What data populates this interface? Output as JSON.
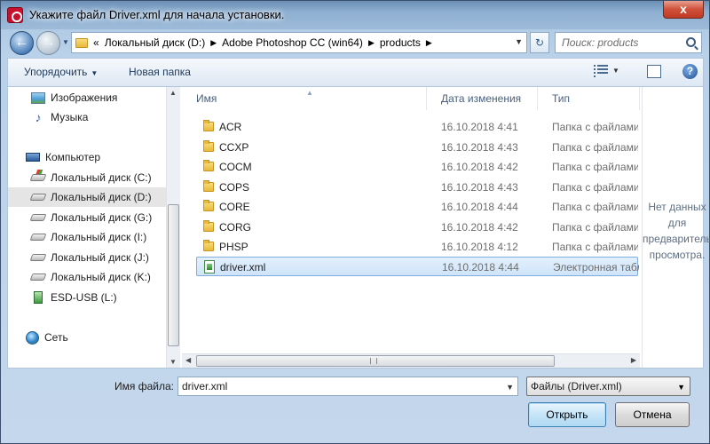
{
  "window": {
    "title": "Укажите файл Driver.xml для начала установки.",
    "close_label": "x"
  },
  "address": {
    "breadcrumbs": [
      "«",
      "Локальный диск (D:)",
      "Adobe Photoshop CC (win64)",
      "products"
    ],
    "search_placeholder": "Поиск: products"
  },
  "toolbar": {
    "organize": "Упорядочить",
    "new_folder": "Новая папка",
    "help": "?"
  },
  "sidebar": {
    "items": [
      {
        "label": "Изображения",
        "icon": "pictures-icon"
      },
      {
        "label": "Музыка",
        "icon": "music-icon"
      },
      {
        "label": "Компьютер",
        "icon": "computer-icon"
      },
      {
        "label": "Локальный диск (C:)",
        "icon": "system-drive-icon"
      },
      {
        "label": "Локальный диск (D:)",
        "icon": "drive-icon",
        "selected": true
      },
      {
        "label": "Локальный диск (G:)",
        "icon": "drive-icon"
      },
      {
        "label": "Локальный диск (I:)",
        "icon": "drive-icon"
      },
      {
        "label": "Локальный диск (J:)",
        "icon": "drive-icon"
      },
      {
        "label": "Локальный диск (K:)",
        "icon": "drive-icon"
      },
      {
        "label": "ESD-USB (L:)",
        "icon": "usb-drive-icon"
      },
      {
        "label": "Сеть",
        "icon": "network-icon"
      }
    ]
  },
  "columns": {
    "name": "Имя",
    "date": "Дата изменения",
    "type": "Тип"
  },
  "files": [
    {
      "name": "ACR",
      "date": "16.10.2018 4:41",
      "type": "Папка с файлами"
    },
    {
      "name": "CCXP",
      "date": "16.10.2018 4:43",
      "type": "Папка с файлами"
    },
    {
      "name": "COCM",
      "date": "16.10.2018 4:42",
      "type": "Папка с файлами"
    },
    {
      "name": "COPS",
      "date": "16.10.2018 4:43",
      "type": "Папка с файлами"
    },
    {
      "name": "CORE",
      "date": "16.10.2018 4:44",
      "type": "Папка с файлами"
    },
    {
      "name": "CORG",
      "date": "16.10.2018 4:42",
      "type": "Папка с файлами"
    },
    {
      "name": "PHSP",
      "date": "16.10.2018 4:12",
      "type": "Папка с файлами"
    },
    {
      "name": "driver.xml",
      "date": "16.10.2018 4:44",
      "type": "Электронная таблица",
      "selected": true
    }
  ],
  "preview": {
    "text": "Нет данных для предварительного просмотра."
  },
  "bottom": {
    "filename_label": "Имя файла:",
    "filename_value": "driver.xml",
    "filter_value": "Файлы (Driver.xml)",
    "open_button": "Открыть",
    "cancel_button": "Отмена"
  },
  "colors": {
    "selection": "#cfe4fa",
    "selection_border": "#84acdd",
    "title_gradient": "#8fb0d2"
  }
}
